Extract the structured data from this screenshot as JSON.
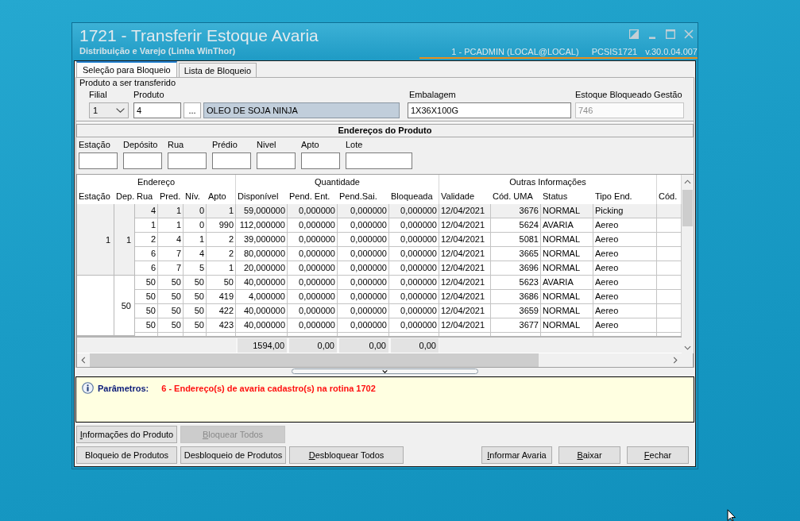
{
  "window": {
    "title": "1721 - Transferir Estoque Avaria",
    "subtitle": "Distribuição e Varejo (Linha WinThor)",
    "user": "1 - PCADMIN (LOCAL@LOCAL)",
    "program": "PCSIS1721",
    "version": "v.30.0.04.007"
  },
  "tabs": [
    {
      "label": "Seleção para Bloqueio",
      "selected": true
    },
    {
      "label": "Lista de Bloqueio",
      "selected": false
    }
  ],
  "product": {
    "title": "Produto a ser transferido",
    "filial": {
      "label": "Filial",
      "value": "1"
    },
    "produto": {
      "label": "Produto",
      "code": "4",
      "browse_button": "...",
      "description": "OLEO DE SOJA NINJA"
    },
    "embalagem": {
      "label": "Embalagem",
      "value": "1X36X100G"
    },
    "estoque_bloqueado": {
      "label": "Estoque Bloqueado Gestão",
      "value": "746",
      "disabled": true
    }
  },
  "addresses": {
    "title": "Endereços do Produto",
    "filters": [
      "Estação",
      "Depósito",
      "Rua",
      "Prédio",
      "Nivel",
      "Apto",
      "Lote"
    ]
  },
  "grid": {
    "column_groups": [
      {
        "label": "Endereço",
        "columns": [
          "Estação",
          "Dep.",
          "Rua",
          "Pred.",
          "Nív.",
          "Apto"
        ]
      },
      {
        "label": "Quantidade",
        "columns": [
          "Disponível",
          "Pend. Ent.",
          "Pend.Sai.",
          "Bloqueada"
        ]
      },
      {
        "label": "Outras Informações",
        "columns": [
          "Validade",
          "Cód. UMA",
          "Status",
          "Tipo End."
        ]
      },
      {
        "columns": [
          "Cód."
        ]
      }
    ],
    "groups": [
      {
        "station": "1",
        "depots": [
          {
            "depot": "1",
            "rows": [
              {
                "cells": [
                  "4",
                  "1",
                  "0",
                  "1",
                  "59,000000",
                  "0,000000",
                  "0,000000",
                  "0,000000",
                  "12/04/2021",
                  "3676",
                  "NORMAL",
                  "Picking"
                ],
                "selected": true
              },
              {
                "cells": [
                  "1",
                  "1",
                  "0",
                  "990",
                  "112,000000",
                  "0,000000",
                  "0,000000",
                  "0,000000",
                  "12/04/2021",
                  "5624",
                  "AVARIA",
                  "Aereo"
                ],
                "selected": false
              },
              {
                "cells": [
                  "2",
                  "4",
                  "1",
                  "2",
                  "39,000000",
                  "0,000000",
                  "0,000000",
                  "0,000000",
                  "12/04/2021",
                  "5081",
                  "NORMAL",
                  "Aereo"
                ],
                "selected": false
              },
              {
                "cells": [
                  "6",
                  "7",
                  "4",
                  "2",
                  "80,000000",
                  "0,000000",
                  "0,000000",
                  "0,000000",
                  "12/04/2021",
                  "3665",
                  "NORMAL",
                  "Aereo"
                ],
                "selected": false
              },
              {
                "cells": [
                  "6",
                  "7",
                  "5",
                  "1",
                  "20,000000",
                  "0,000000",
                  "0,000000",
                  "0,000000",
                  "12/04/2021",
                  "3696",
                  "NORMAL",
                  "Aereo"
                ],
                "selected": false
              }
            ]
          }
        ]
      },
      {
        "depots": [
          {
            "depot": "50",
            "rows": [
              {
                "cells": [
                  "50",
                  "50",
                  "50",
                  "50",
                  "40,000000",
                  "0,000000",
                  "0,000000",
                  "0,000000",
                  "12/04/2021",
                  "5623",
                  "AVARIA",
                  "Aereo"
                ],
                "selected": false
              },
              {
                "cells": [
                  "50",
                  "50",
                  "50",
                  "419",
                  "4,000000",
                  "0,000000",
                  "0,000000",
                  "0,000000",
                  "12/04/2021",
                  "3686",
                  "NORMAL",
                  "Aereo"
                ],
                "selected": false
              },
              {
                "cells": [
                  "50",
                  "50",
                  "50",
                  "422",
                  "40,000000",
                  "0,000000",
                  "0,000000",
                  "0,000000",
                  "12/04/2021",
                  "3659",
                  "NORMAL",
                  "Aereo"
                ],
                "selected": false
              },
              {
                "cells": [
                  "50",
                  "50",
                  "50",
                  "423",
                  "40,000000",
                  "0,000000",
                  "0,000000",
                  "0,000000",
                  "12/04/2021",
                  "3677",
                  "NORMAL",
                  "Aereo"
                ],
                "selected": false
              }
            ]
          }
        ]
      }
    ],
    "totals": [
      "1594,00",
      "0,00",
      "0,00",
      "0,00"
    ]
  },
  "info": {
    "label": "Parâmetros:",
    "message": "6 - Endereço(s) de avaria cadastro(s) na rotina 1702"
  },
  "button_rows": [
    {
      "left": [
        {
          "label": "Informações do Produto",
          "mnemonic": true,
          "disabled": false
        },
        {
          "label": "Bloquear Todos",
          "mnemonic": true,
          "disabled": true
        }
      ]
    },
    {
      "left": [
        {
          "label": "Bloqueio de Produtos",
          "mnemonic": false,
          "disabled": false
        },
        {
          "label": "Desbloqueio de Produtos",
          "mnemonic": false,
          "disabled": false
        },
        {
          "label": "Desbloquear Todos",
          "mnemonic": true,
          "disabled": false
        }
      ],
      "right": [
        {
          "label": "Informar Avaria",
          "mnemonic": true,
          "disabled": false
        },
        {
          "label": "Baixar",
          "mnemonic": true,
          "disabled": false
        },
        {
          "label": "Fechar",
          "mnemonic": true,
          "disabled": false
        }
      ]
    }
  ]
}
